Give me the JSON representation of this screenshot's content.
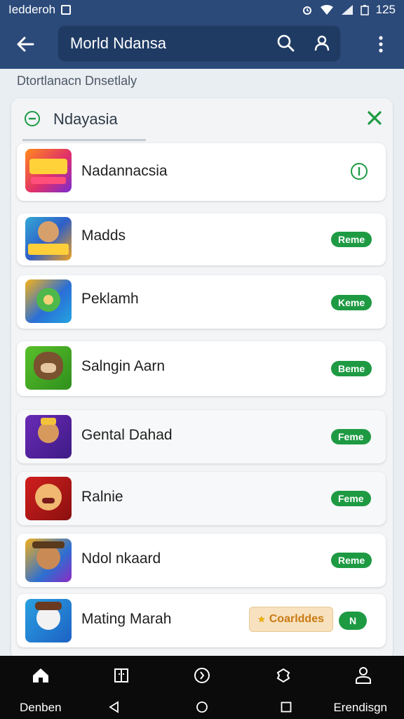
{
  "status_bar": {
    "left_text": "Iedderoh",
    "time": "125"
  },
  "app_bar": {
    "search_text": "Morld Ndansa"
  },
  "subtitle": "Dtortlanacn Dnsetlaly",
  "panel": {
    "title": "Ndayasia"
  },
  "items": [
    {
      "label": "Nadannacsia",
      "badge": ""
    },
    {
      "label": "Madds",
      "badge": "Reme"
    },
    {
      "label": "Peklamh",
      "badge": "Keme"
    },
    {
      "label": "Salngin Aarn",
      "badge": "Beme"
    },
    {
      "label": "Gental Dahad",
      "badge": "Feme"
    },
    {
      "label": "Ralnie",
      "badge": "Feme"
    },
    {
      "label": "Ndol nkaard",
      "badge": "Reme"
    },
    {
      "label": "Mating Marah",
      "badge": "N",
      "button_label": "Coarlddes"
    }
  ],
  "bottom_nav": {
    "left_label": "Denben",
    "right_label": "Erendisgn"
  },
  "colors": {
    "appbar": "#2b4a7a",
    "accent_green": "#1e9a43",
    "nav_bg": "#0b0b0b"
  }
}
